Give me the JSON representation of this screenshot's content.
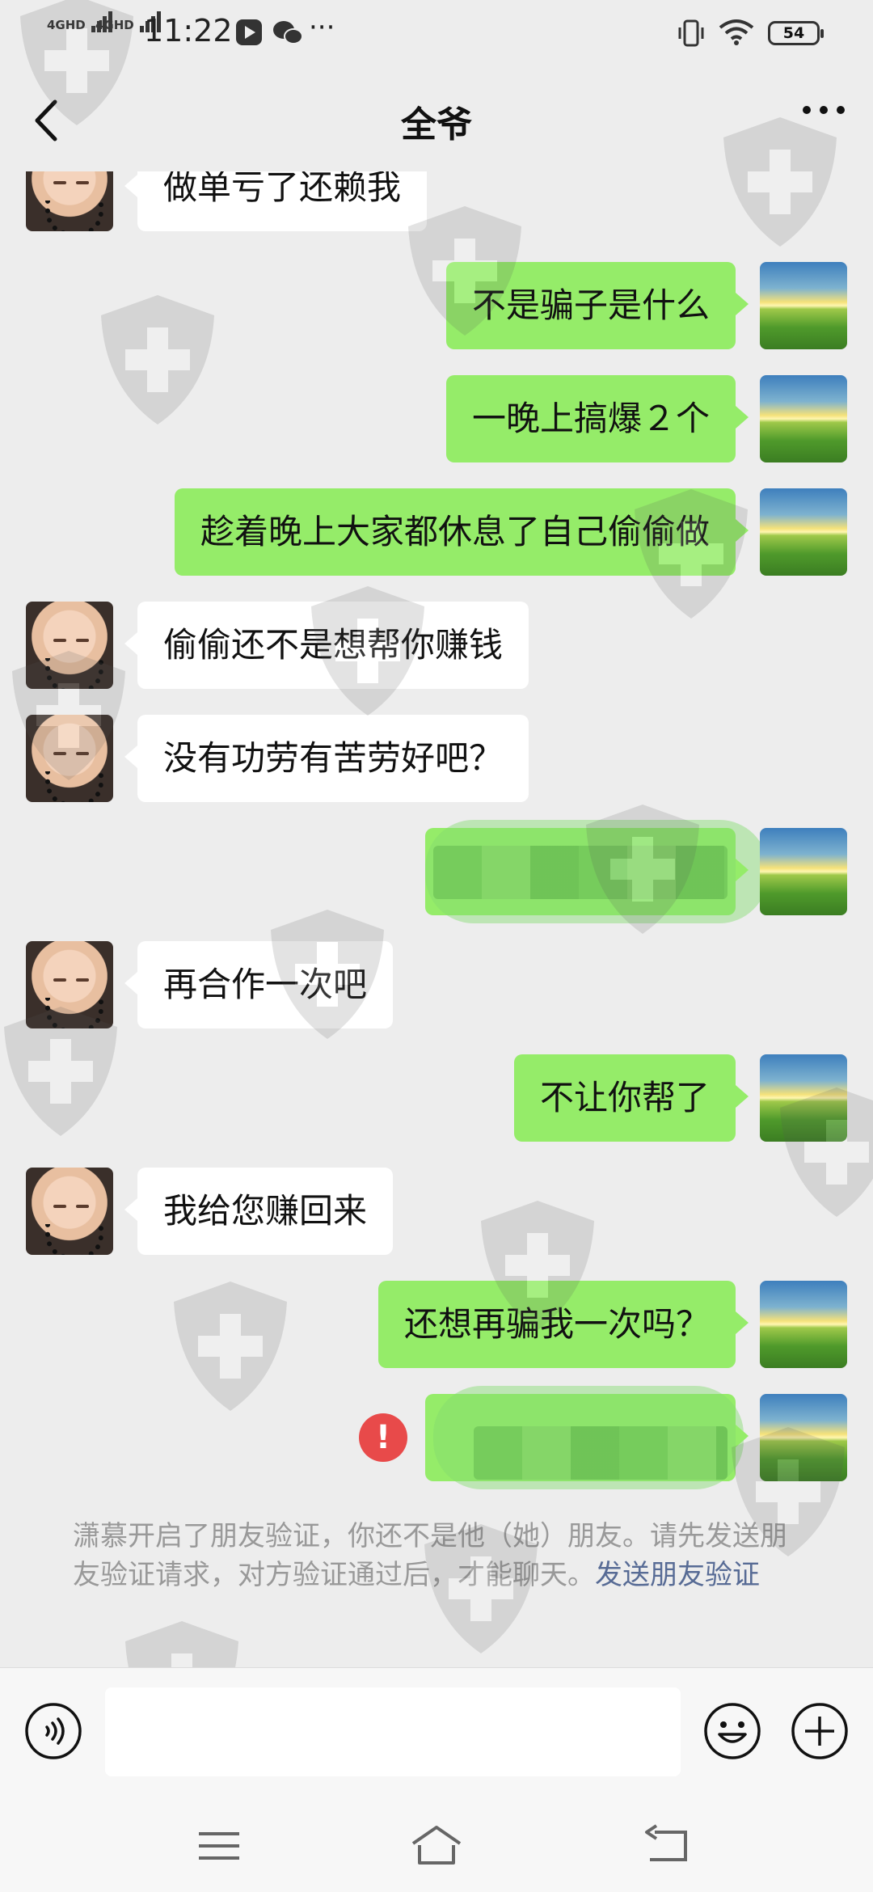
{
  "status_bar": {
    "signal1": "4GHD",
    "signal2": "4GHD",
    "time": "11:22",
    "more_dots": "···",
    "battery": "54"
  },
  "header": {
    "title": "全爷"
  },
  "messages": [
    {
      "side": "in",
      "text": "做单亏了还赖我"
    },
    {
      "side": "out",
      "text": "不是骗子是什么"
    },
    {
      "side": "out",
      "text": "一晚上搞爆２个"
    },
    {
      "side": "out",
      "text": "趁着晚上大家都休息了自己偷偷做"
    },
    {
      "side": "in",
      "text": "偷偷还不是想帮你赚钱"
    },
    {
      "side": "in",
      "text": "没有功劳有苦劳好吧？"
    },
    {
      "side": "out",
      "text": "",
      "redacted": true
    },
    {
      "side": "in",
      "text": "再合作一次吧"
    },
    {
      "side": "out",
      "text": "不让你帮了"
    },
    {
      "side": "in",
      "text": "我给您赚回来"
    },
    {
      "side": "out",
      "text": "还想再骗我一次吗？"
    },
    {
      "side": "out",
      "text": "",
      "redacted": true,
      "failed": true
    }
  ],
  "error_mark": "!",
  "notice": {
    "text": "潇慕开启了朋友验证，你还不是他（她）朋友。请先发送朋友验证请求，对方验证通过后，才能聊天。",
    "link": "发送朋友验证"
  },
  "input": {
    "value": ""
  }
}
